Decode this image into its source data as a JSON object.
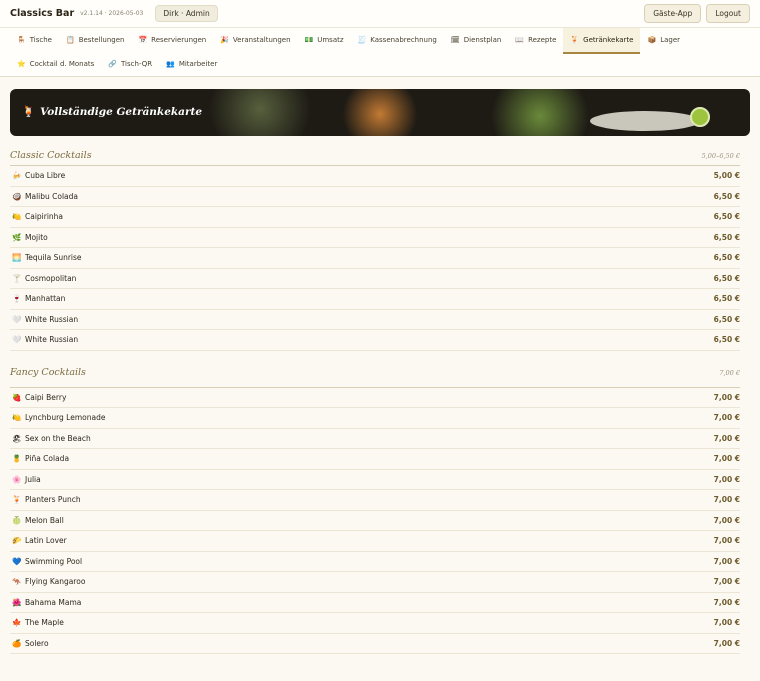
{
  "header": {
    "app_title": "Classics Bar",
    "version": "v2.1.14 · 2026-05-03",
    "user": "Dirk · Admin",
    "guest_app_label": "Gäste-App",
    "logout_label": "Logout"
  },
  "nav": {
    "row1": [
      {
        "icon": "🪑",
        "label": "Tische"
      },
      {
        "icon": "📋",
        "label": "Bestellungen"
      },
      {
        "icon": "📅",
        "label": "Reservierungen"
      },
      {
        "icon": "🎉",
        "label": "Veranstaltungen"
      },
      {
        "icon": "💵",
        "label": "Umsatz"
      },
      {
        "icon": "🧾",
        "label": "Kassenabrechnung"
      },
      {
        "icon": "🗓",
        "label": "Dienstplan"
      },
      {
        "icon": "📖",
        "label": "Rezepte"
      },
      {
        "icon": "🍹",
        "label": "Getränkekarte"
      },
      {
        "icon": "📦",
        "label": "Lager"
      }
    ],
    "row2": [
      {
        "icon": "⭐",
        "label": "Cocktail d. Monats"
      },
      {
        "icon": "🔗",
        "label": "Tisch-QR"
      },
      {
        "icon": "👥",
        "label": "Mitarbeiter"
      }
    ],
    "active": "Getränkekarte"
  },
  "hero": {
    "icon": "🍹",
    "title": "Vollständige Getränkekarte"
  },
  "sections": [
    {
      "title": "Classic Cocktails",
      "range": "5,00–6,50 €",
      "items": [
        {
          "icon": "🍻",
          "name": "Cuba Libre",
          "price": "5,00 €"
        },
        {
          "icon": "🥥",
          "name": "Malibu Colada",
          "price": "6,50 €"
        },
        {
          "icon": "🍋",
          "name": "Caipirinha",
          "price": "6,50 €"
        },
        {
          "icon": "🌿",
          "name": "Mojito",
          "price": "6,50 €"
        },
        {
          "icon": "🌅",
          "name": "Tequila Sunrise",
          "price": "6,50 €"
        },
        {
          "icon": "🍸",
          "name": "Cosmopolitan",
          "price": "6,50 €"
        },
        {
          "icon": "🍷",
          "name": "Manhattan",
          "price": "6,50 €"
        },
        {
          "icon": "🤍",
          "name": "White Russian",
          "price": "6,50 €"
        },
        {
          "icon": "🤍",
          "name": "White Russian",
          "price": "6,50 €"
        }
      ]
    },
    {
      "title": "Fancy Cocktails",
      "range": "7,00 €",
      "items": [
        {
          "icon": "🍓",
          "name": "Caipi Berry",
          "price": "7,00 €"
        },
        {
          "icon": "🍋",
          "name": "Lynchburg Lemonade",
          "price": "7,00 €"
        },
        {
          "icon": "🏖",
          "name": "Sex on the Beach",
          "price": "7,00 €"
        },
        {
          "icon": "🍍",
          "name": "Piña Colada",
          "price": "7,00 €"
        },
        {
          "icon": "🌸",
          "name": "Julia",
          "price": "7,00 €"
        },
        {
          "icon": "🍹",
          "name": "Planters Punch",
          "price": "7,00 €"
        },
        {
          "icon": "🍈",
          "name": "Melon Ball",
          "price": "7,00 €"
        },
        {
          "icon": "🌮",
          "name": "Latin Lover",
          "price": "7,00 €"
        },
        {
          "icon": "💙",
          "name": "Swimming Pool",
          "price": "7,00 €"
        },
        {
          "icon": "🦘",
          "name": "Flying Kangaroo",
          "price": "7,00 €"
        },
        {
          "icon": "🌺",
          "name": "Bahama Mama",
          "price": "7,00 €"
        },
        {
          "icon": "🍁",
          "name": "The Maple",
          "price": "7,00 €"
        },
        {
          "icon": "🍊",
          "name": "Solero",
          "price": "7,00 €"
        }
      ]
    }
  ],
  "colors": {
    "accent": "#a8863f",
    "background": "#fbf9f2",
    "price": "#6e5b2c",
    "section_title": "#7d6a3e"
  }
}
